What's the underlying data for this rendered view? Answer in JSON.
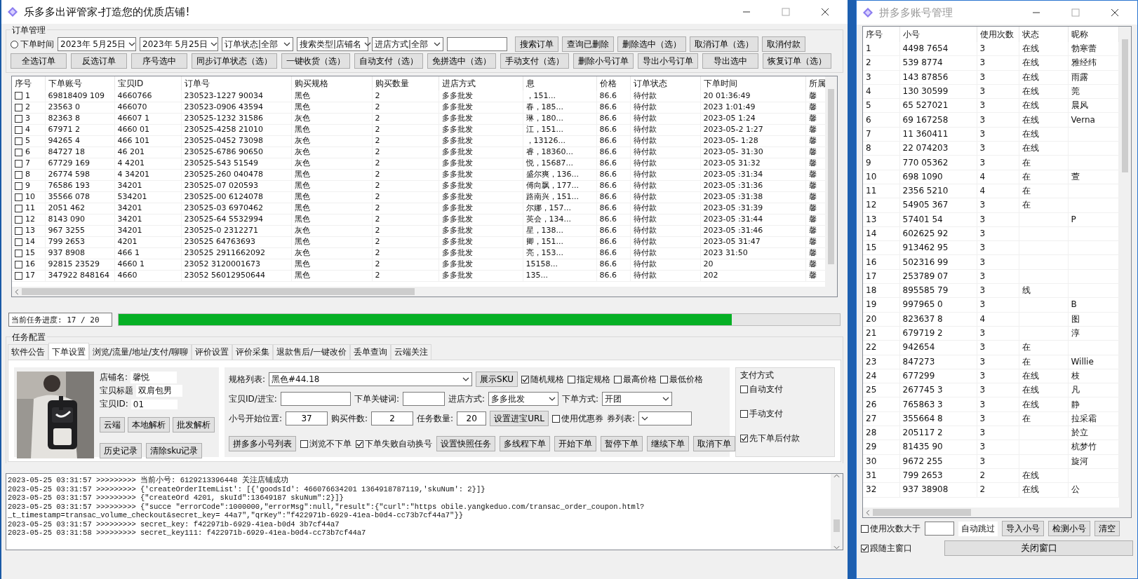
{
  "main_window": {
    "title": "乐多多出评管家-打造您的优质店铺!"
  },
  "order_management": {
    "title": "订单管理",
    "date_filter": {
      "label": "下单时间",
      "selected": false
    },
    "date_from": "2023年  5月25日",
    "date_to": "2023年  5月25日",
    "dropdowns": [
      "订单状态|全部",
      "搜索类型|店铺名",
      "进店方式|全部"
    ],
    "buttons_row1": [
      "搜索订单",
      "查询已删除",
      "删除选中（选）",
      "取消订单（选）",
      "取消付款"
    ],
    "buttons_row2": [
      "全选订单",
      "反选订单",
      "序号选中",
      "同步订单状态（选）",
      "一键收货（选）",
      "自动支付（选）",
      "免拼选中（选）",
      "手动支付（选）",
      "删除小号订单",
      "导出小号订单",
      "导出选中",
      "恢复订单（选）"
    ]
  },
  "orders_table": {
    "columns": [
      "序号",
      "下单账号",
      "宝贝ID",
      "订单号",
      "购买规格",
      "购买数量",
      "进店方式",
      "息",
      "价格",
      "订单状态",
      "下单时间",
      "所属"
    ],
    "rows": [
      {
        "checked": false,
        "cells": [
          "1",
          "69818409 109",
          "4660766",
          "230523-1227 90034",
          "黑色",
          "2",
          "多多批发",
          "，151...",
          "86.6",
          "待付款",
          "20 01:36:49",
          "馨"
        ]
      },
      {
        "checked": false,
        "cells": [
          "2",
          "23563 0",
          "466070",
          "230523-0906 43594",
          "黑色",
          "2",
          "多多批发",
          "春，185...",
          "86.6",
          "待付款",
          "2023 1:01:49",
          "馨"
        ]
      },
      {
        "checked": false,
        "cells": [
          "3",
          "82363 8",
          "46607 1",
          "230525-1232 31586",
          "灰色",
          "2",
          "多多批发",
          "琳，180...",
          "86.6",
          "待付款",
          "2023-05 1:24",
          "馨"
        ]
      },
      {
        "checked": false,
        "cells": [
          "4",
          "67971 2",
          "4660 01",
          "230525-4258 21010",
          "黑色",
          "2",
          "多多批发",
          "江，151...",
          "86.6",
          "待付款",
          "2023-05-2 1:27",
          "馨"
        ]
      },
      {
        "checked": false,
        "cells": [
          "5",
          "94265 4",
          "466 101",
          "230525-0452 73098",
          "灰色",
          "2",
          "多多批发",
          "，13126...",
          "86.6",
          "待付款",
          "2023-05- 1:28",
          "馨"
        ]
      },
      {
        "checked": false,
        "cells": [
          "6",
          "84727 18",
          "46 201",
          "230525-6786 90650",
          "灰色",
          "2",
          "多多批发",
          "睿，18360...",
          "86.6",
          "待付款",
          "2023-05- 31:30",
          "馨"
        ]
      },
      {
        "checked": false,
        "cells": [
          "7",
          "67729 169",
          "4 4201",
          "230525-543 51549",
          "灰色",
          "2",
          "多多批发",
          "悦，15687...",
          "86.6",
          "待付款",
          "2023-05 31:32",
          "馨"
        ]
      },
      {
        "checked": false,
        "cells": [
          "8",
          "26774 598",
          "4 34201",
          "230525-260 040478",
          "黑色",
          "2",
          "多多批发",
          "盛尔爽，136...",
          "86.6",
          "待付款",
          "2023-05 :31:34",
          "馨"
        ]
      },
      {
        "checked": false,
        "cells": [
          "9",
          "76586 193",
          "34201",
          "230525-07 020593",
          "黑色",
          "2",
          "多多批发",
          "傅向飘，177...",
          "86.6",
          "待付款",
          "2023-05 :31:36",
          "馨"
        ]
      },
      {
        "checked": false,
        "cells": [
          "10",
          "35566 078",
          "534201",
          "230525-00 6124078",
          "黑色",
          "2",
          "多多批发",
          "路南兴，151...",
          "86.6",
          "待付款",
          "2023-05 :31:38",
          "馨"
        ]
      },
      {
        "checked": false,
        "cells": [
          "11",
          "2051 462",
          "34201",
          "230525-03 6970462",
          "黑色",
          "2",
          "多多批发",
          "尔娜，157...",
          "86.6",
          "待付款",
          "2023-05 :31:39",
          "馨"
        ]
      },
      {
        "checked": false,
        "cells": [
          "12",
          "8143 090",
          "34201",
          "230525-64 5532994",
          "黑色",
          "2",
          "多多批发",
          "英会，134...",
          "86.6",
          "待付款",
          "2023-05 :31:44",
          "馨"
        ]
      },
      {
        "checked": false,
        "cells": [
          "13",
          "967 3255",
          "34201",
          "230525-0 2312271",
          "灰色",
          "2",
          "多多批发",
          "星，138...",
          "86.6",
          "待付款",
          "2023-05 :31:46",
          "馨"
        ]
      },
      {
        "checked": false,
        "cells": [
          "14",
          "799 2653",
          "4201",
          "230525 64763693",
          "黑色",
          "2",
          "多多批发",
          "卿，151...",
          "86.6",
          "待付款",
          "2023-05 31:47",
          "馨"
        ]
      },
      {
        "checked": false,
        "cells": [
          "15",
          "937 8908",
          "466 1",
          "230525 2911662092",
          "灰色",
          "2",
          "多多批发",
          "亮，153...",
          "86.6",
          "待付款",
          "2023 31:50",
          "馨"
        ]
      },
      {
        "checked": false,
        "cells": [
          "16",
          "92815 23529",
          "4660 1",
          "23052 3120001673",
          "黑色",
          "2",
          "多多批发",
          "15158...",
          "86.6",
          "待付款",
          "20",
          "馨"
        ]
      },
      {
        "checked": false,
        "cells": [
          "17",
          "347922 848164",
          "4660",
          "23052 56012950644",
          "黑色",
          "2",
          "多多批发",
          "135...",
          "86.6",
          "待付款",
          "202",
          "馨"
        ]
      }
    ]
  },
  "progress": {
    "label": "当前任务进度: 17 / 20",
    "level": 0.85
  },
  "task_config": {
    "title": "任务配置",
    "tabs": [
      {
        "label": "软件公告",
        "selected": false
      },
      {
        "label": "下单设置",
        "selected": true
      },
      {
        "label": "浏览/流量/地址/支付/聊聊",
        "selected": false
      },
      {
        "label": "评价设置",
        "selected": false
      },
      {
        "label": "评价采集",
        "selected": false
      },
      {
        "label": "退款售后/一键改价",
        "selected": false
      },
      {
        "label": "丢单查询",
        "selected": false
      },
      {
        "label": "云端关注",
        "selected": false
      }
    ],
    "product": {
      "kind": "picture",
      "fields": [
        {
          "label": "店铺名:",
          "value": "馨悦"
        },
        {
          "label": "宝贝标题",
          "value": "双肩包男"
        },
        {
          "label": "宝贝ID:",
          "value": "01"
        }
      ],
      "buttons": [
        "云端",
        "本地解析",
        "批发解析"
      ],
      "buttons2": [
        "历史记录",
        "清除sku记录"
      ]
    },
    "spec_label": "规格列表:",
    "spec_value": "黑色#44.18",
    "show_sku": "展示SKU",
    "spec_options": [
      {
        "label": "随机规格",
        "checked": true
      },
      {
        "label": "指定规格",
        "checked": false
      },
      {
        "label": "最高价格",
        "checked": false
      },
      {
        "label": "最低价格",
        "checked": false
      }
    ],
    "id_label": "宝贝ID/进宝:",
    "keyword_label": "下单关键词:",
    "entry_label": "进店方式:",
    "entry_value": "多多批发",
    "mode_label": "下单方式:",
    "mode_value": "开团",
    "start_label": "小号开始位置:",
    "start_value": "37",
    "qty_label": "购买件数:",
    "qty_value": "2",
    "count_label": "任务数量:",
    "count_value": "20",
    "url_button": "设置进宝URL",
    "coupon": {
      "label": "使用优惠券",
      "checked": false
    },
    "coupon_list_label": "券列表:",
    "account_list_button": "拼多多小号列表",
    "browse_only": {
      "label": "浏览不下单",
      "checked": false
    },
    "auto_switch": {
      "label": "下单失败自动换号",
      "checked": true
    },
    "action_buttons": [
      "设置快照任务",
      "多线程下单",
      "开始下单",
      "暂停下单",
      "继续下单",
      "取消下单"
    ],
    "payment": {
      "title": "支付方式",
      "options": [
        {
          "label": "自动支付",
          "checked": false
        },
        {
          "label": "手动支付",
          "checked": false
        },
        {
          "label": "先下单后付款",
          "checked": true
        }
      ]
    }
  },
  "log": [
    "2023-05-25 03:31:57 >>>>>>>>> 当前小号: 6129213396448 关注店铺成功",
    "2023-05-25 03:31:57 >>>>>>>>> {'createOrderItemList': [{'goodsId': 466076634201 1364918787119,'skuNum': 2}]}",
    "2023-05-25 03:31:57 >>>>>>>>> {\"createOrd 4201, skuId\":13649187 skuNum\":2}]}",
    "2023-05-25 03:31:57 >>>>>>>>> {\"succe \"errorCode\":1000000,\"errorMsg\":null,\"result\":{\"curl\":\"https obile.yangkeduo.com/transac_order_coupon.html?",
    "_t_timestamp=transac_volume_checkout&secret_key= 44a7\",\"qrKey\":\"f422971b-6929-41ea-b0d4-cc73b7cf44a7\"}}",
    "2023-05-25 03:31:57 >>>>>>>>> secret_key: f422971b-6929-41ea-b0d4 3b7cf44a7",
    "2023-05-25 03:31:58 >>>>>>>>> secret_key111: f422971b-6929-41ea-b0d4-cc73b7cf44a7"
  ],
  "account_window": {
    "title": "拼多多账号管理",
    "columns": [
      "序号",
      "小号",
      "使用次数",
      "状态",
      "昵称"
    ],
    "rows": [
      {
        "no": "1",
        "account": "4498 7654",
        "uses": "3",
        "status": "在线",
        "nick": "勃寒蕾"
      },
      {
        "no": "2",
        "account": "539 8774",
        "uses": "3",
        "status": "在线",
        "nick": "雅经纬"
      },
      {
        "no": "3",
        "account": "143 87856",
        "uses": "3",
        "status": "在线",
        "nick": "雨露"
      },
      {
        "no": "4",
        "account": "130 30599",
        "uses": "3",
        "status": "在线",
        "nick": "莞"
      },
      {
        "no": "5",
        "account": "65 527021",
        "uses": "3",
        "status": "在线",
        "nick": "晨风"
      },
      {
        "no": "6",
        "account": "69 167258",
        "uses": "3",
        "status": "在线",
        "nick": "Verna"
      },
      {
        "no": "7",
        "account": "11 360411",
        "uses": "3",
        "status": "在线"
      },
      {
        "no": "8",
        "account": "22 074203",
        "uses": "3",
        "status": "在线"
      },
      {
        "no": "9",
        "account": "770 05362",
        "uses": "3",
        "status": "在"
      },
      {
        "no": "10",
        "account": "698 1090",
        "uses": "4",
        "status": "在",
        "nick": "萱"
      },
      {
        "no": "11",
        "account": "2356 5210",
        "uses": "4",
        "status": "在"
      },
      {
        "no": "12",
        "account": "54905 367",
        "uses": "3",
        "status": "在"
      },
      {
        "no": "13",
        "account": "57401 54",
        "uses": "3",
        "nick": "P"
      },
      {
        "no": "14",
        "account": "602625 92",
        "uses": "3"
      },
      {
        "no": "15",
        "account": "913462 95",
        "uses": "3"
      },
      {
        "no": "16",
        "account": "502316 99",
        "uses": "3"
      },
      {
        "no": "17",
        "account": "253789 07",
        "uses": "3"
      },
      {
        "no": "18",
        "account": "895585 79",
        "uses": "3",
        "status": "线"
      },
      {
        "no": "19",
        "account": "997965 0",
        "uses": "3",
        "nick": "B"
      },
      {
        "no": "20",
        "account": "823637 8",
        "uses": "4",
        "nick": "图"
      },
      {
        "no": "21",
        "account": "679719 2",
        "uses": "3",
        "nick": "淳"
      },
      {
        "no": "22",
        "account": "942654",
        "uses": "3",
        "status": "在"
      },
      {
        "no": "23",
        "account": "847273",
        "uses": "3",
        "status": "在",
        "nick": "Willie"
      },
      {
        "no": "24",
        "account": "677299",
        "uses": "3",
        "status": "在线",
        "nick": "枝"
      },
      {
        "no": "25",
        "account": "267745 3",
        "uses": "3",
        "status": "在线",
        "nick": "凡"
      },
      {
        "no": "26",
        "account": "765863 3",
        "uses": "3",
        "status": "在线",
        "nick": "静"
      },
      {
        "no": "27",
        "account": "355664 8",
        "uses": "3",
        "status": "在",
        "nick": "拉采霜"
      },
      {
        "no": "28",
        "account": "205117 2",
        "uses": "3",
        "nick": "於立"
      },
      {
        "no": "29",
        "account": "81435 90",
        "uses": "3",
        "nick": "杭梦竹"
      },
      {
        "no": "30",
        "account": "9672 255",
        "uses": "3",
        "nick": "旋河"
      },
      {
        "no": "31",
        "account": "799 2653",
        "uses": "2",
        "status": "在线"
      },
      {
        "no": "32",
        "account": "937 38908",
        "uses": "2",
        "status": "在线",
        "nick": "公"
      }
    ],
    "skip_filter": {
      "label": "使用次数大于",
      "checked": false
    },
    "skip_text": "自动跳过",
    "buttons": [
      "导入小号",
      "检测小号",
      "清空"
    ],
    "follow": {
      "label": "跟随主窗口",
      "checked": true
    },
    "close_button": "关闭窗口"
  }
}
